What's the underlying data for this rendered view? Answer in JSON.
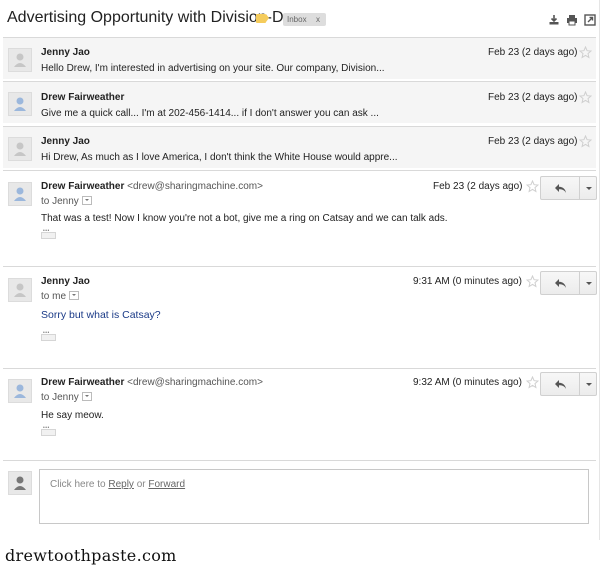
{
  "thread": {
    "subject": "Advertising Opportunity with Division-D",
    "label": "Inbox",
    "label_close": "x",
    "label_color": "#f5cc5c"
  },
  "collapsed": [
    {
      "sender": "Jenny Jao",
      "snippet": "Hello Drew, I'm interested in advertising on your site. Our company, Division...",
      "date": "Feb 23 (2 days ago)"
    },
    {
      "sender": "Drew Fairweather",
      "snippet": "Give me a quick call... I'm at 202-456-1414... if I don't answer you can ask ...",
      "date": "Feb 23 (2 days ago)"
    },
    {
      "sender": "Jenny Jao",
      "snippet": "Hi Drew, As much as I love America, I don't think the White House would appre...",
      "date": "Feb 23 (2 days ago)"
    }
  ],
  "messages": [
    {
      "sender": "Drew Fairweather",
      "email": "<drew@sharingmachine.com>",
      "date": "Feb 23 (2 days ago)",
      "to": "to Jenny",
      "body": "That was a test! Now I know you're not a bot, give me a ring on Catsay and we can talk ads."
    },
    {
      "sender": "Jenny Jao",
      "email": "",
      "date": "9:31 AM (0 minutes ago)",
      "to": "to me",
      "body": "Sorry but what is Catsay?"
    },
    {
      "sender": "Drew Fairweather",
      "email": "<drew@sharingmachine.com>",
      "date": "9:32 AM (0 minutes ago)",
      "to": "to Jenny",
      "body": "He say meow."
    }
  ],
  "reply": {
    "prefix": "Click here to ",
    "reply_link": "Reply",
    "or": " or ",
    "forward_link": "Forward"
  },
  "watermark": "drewtoothpaste.com"
}
